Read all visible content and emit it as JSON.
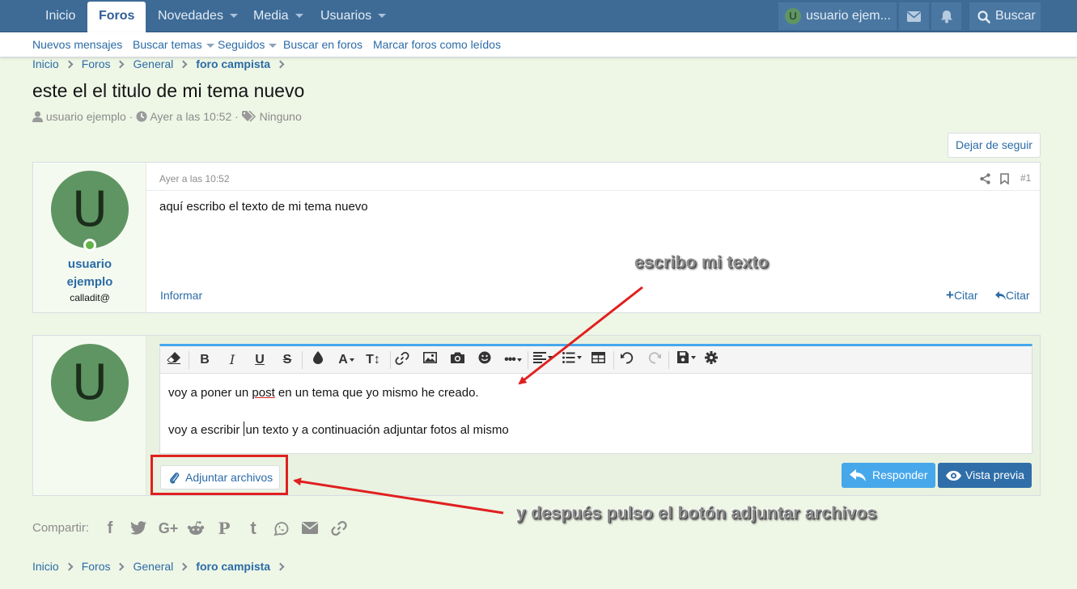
{
  "nav": {
    "tabs": [
      {
        "label": "Inicio"
      },
      {
        "label": "Foros"
      },
      {
        "label": "Novedades"
      },
      {
        "label": "Media"
      },
      {
        "label": "Usuarios"
      }
    ],
    "user_label": "usuario ejem...",
    "avatar_letter": "U",
    "search_label": "Buscar"
  },
  "subnav": {
    "items": [
      {
        "label": "Nuevos mensajes"
      },
      {
        "label": "Buscar temas"
      },
      {
        "label": "Seguidos"
      },
      {
        "label": "Buscar en foros"
      },
      {
        "label": "Marcar foros como leídos"
      }
    ]
  },
  "breadcrumb": {
    "items": [
      "Inicio",
      "Foros",
      "General",
      "foro campista"
    ]
  },
  "thread": {
    "title": "este el el titulo de mi tema nuevo",
    "author": "usuario ejemplo",
    "date": "Ayer a las 10:52",
    "tags": "Ninguno",
    "sep": "·",
    "follow_label": "Dejar de seguir"
  },
  "post": {
    "avatar_letter": "U",
    "username_line1": "usuario",
    "username_line2": "ejemplo",
    "user_title": "calladit@",
    "date": "Ayer a las 10:52",
    "number": "#1",
    "body": "aquí escribo el texto de mi tema nuevo",
    "report_label": "Informar",
    "quote_label": "Citar",
    "reply_quote_label": "Citar"
  },
  "reply": {
    "avatar_letter": "U",
    "line1_before": "voy a poner un ",
    "line1_link": "post",
    "line1_after": " en un tema que yo mismo he creado.",
    "line2_before": "voy a escribir ",
    "line2_after": "un texto y a continuación adjuntar fotos al mismo",
    "attach_label": "Adjuntar archivos",
    "respond_label": "Responder",
    "preview_label": "Vista previa"
  },
  "share": {
    "label": "Compartir:"
  },
  "annotations": {
    "a1": "escribo mi texto",
    "a2": "y después pulso el botón adjuntar archivos"
  },
  "colors": {
    "nav_bg": "#3e6b96",
    "page_bg": "#eef6e6",
    "link": "#2b6ba6",
    "button_light": "#47a7eb",
    "button_dark": "#2f6ea8",
    "annotation_red": "#e02020",
    "avatar": "#5f9562"
  }
}
